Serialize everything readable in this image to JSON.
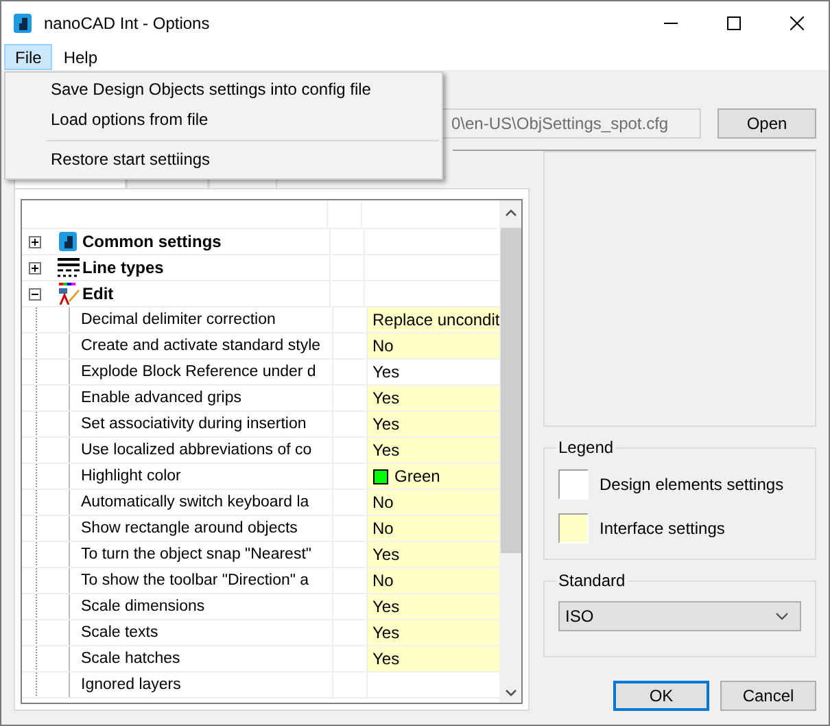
{
  "window": {
    "title": "nanoCAD Int - Options"
  },
  "menubar": [
    {
      "label": "File",
      "selected": true
    },
    {
      "label": "Help",
      "selected": false
    }
  ],
  "file_menu": [
    {
      "label": "Save Design Objects settings into config file",
      "kind": "item"
    },
    {
      "label": "Load options from file",
      "kind": "item"
    },
    {
      "kind": "separator"
    },
    {
      "label": "Restore start settiings",
      "kind": "item"
    }
  ],
  "config": {
    "path": "0\\en-US\\ObjSettings_spot.cfg",
    "button": "Open"
  },
  "tabs": [
    {
      "selected": true
    },
    {
      "selected": false
    },
    {
      "selected": false
    }
  ],
  "tree": [
    {
      "label": "Common settings",
      "expanded": false
    },
    {
      "label": "Line types",
      "expanded": false
    },
    {
      "label": "Edit",
      "expanded": true,
      "children": [
        {
          "name": "Decimal delimiter correction",
          "value": "Replace uncondit",
          "kind": "interface"
        },
        {
          "name": "Create and activate standard style",
          "value": "No",
          "kind": "interface"
        },
        {
          "name": "Explode Block Reference under d",
          "value": "Yes",
          "kind": "design"
        },
        {
          "name": "Enable advanced grips",
          "value": "Yes",
          "kind": "interface"
        },
        {
          "name": "Set associativity during insertion",
          "value": "Yes",
          "kind": "interface"
        },
        {
          "name": "Use localized abbreviations of co",
          "value": "Yes",
          "kind": "interface"
        },
        {
          "name": "Highlight color",
          "value": "Green",
          "kind": "interface",
          "color": "#00ff00"
        },
        {
          "name": "Automatically switch keyboard la",
          "value": "No",
          "kind": "interface"
        },
        {
          "name": "Show rectangle around objects",
          "value": "No",
          "kind": "interface"
        },
        {
          "name": "To turn the object snap \"Nearest\"",
          "value": "Yes",
          "kind": "interface"
        },
        {
          "name": "To show the toolbar \"Direction\" a",
          "value": "No",
          "kind": "interface"
        },
        {
          "name": "Scale dimensions",
          "value": "Yes",
          "kind": "interface"
        },
        {
          "name": "Scale texts",
          "value": "Yes",
          "kind": "interface"
        },
        {
          "name": "Scale hatches",
          "value": "Yes",
          "kind": "interface"
        },
        {
          "name": "Ignored layers",
          "kind": "design"
        }
      ]
    }
  ],
  "legend": {
    "title": "Legend",
    "items": [
      {
        "label": "Design elements settings",
        "kind": "design"
      },
      {
        "label": "Interface settings",
        "kind": "interface"
      }
    ]
  },
  "standard": {
    "title": "Standard",
    "value": "ISO"
  },
  "buttons": [
    {
      "label": "OK",
      "kind": "default"
    },
    {
      "label": "Cancel",
      "kind": "normal"
    }
  ]
}
